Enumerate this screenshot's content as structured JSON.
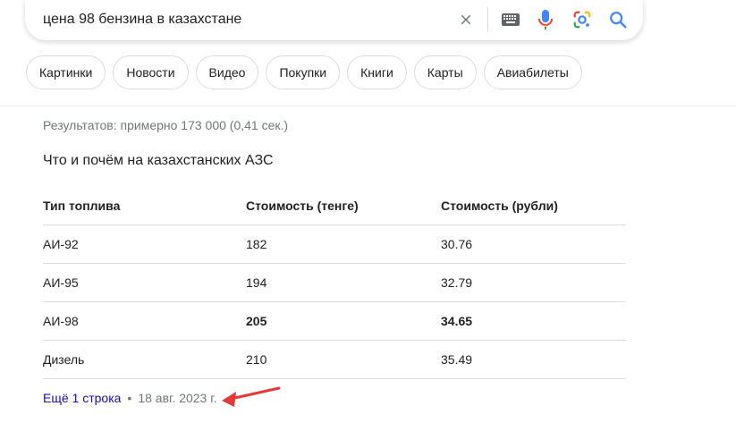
{
  "search": {
    "query": "цена 98 бензина в казахстане"
  },
  "chips": [
    "Картинки",
    "Новости",
    "Видео",
    "Покупки",
    "Книги",
    "Карты",
    "Авиабилеты"
  ],
  "results": {
    "stats": "Результатов: примерно 173 000 (0,41 сек.)"
  },
  "snippet": {
    "title": "Что и почём на казахстанских АЗС",
    "headers": [
      "Тип топлива",
      "Стоимость (тенге)",
      "Стоимость (рубли)"
    ],
    "rows": [
      [
        "АИ-92",
        "182",
        "30.76"
      ],
      [
        "АИ-95",
        "194",
        "32.79"
      ],
      [
        "АИ-98",
        "205",
        "34.65"
      ],
      [
        "Дизель",
        "210",
        "35.49"
      ]
    ],
    "more_link": "Ещё 1 строка",
    "separator": "•",
    "date": "18 авг. 2023 г."
  },
  "colors": {
    "link": "#1a0dab",
    "annotation_arrow": "#e53935"
  }
}
